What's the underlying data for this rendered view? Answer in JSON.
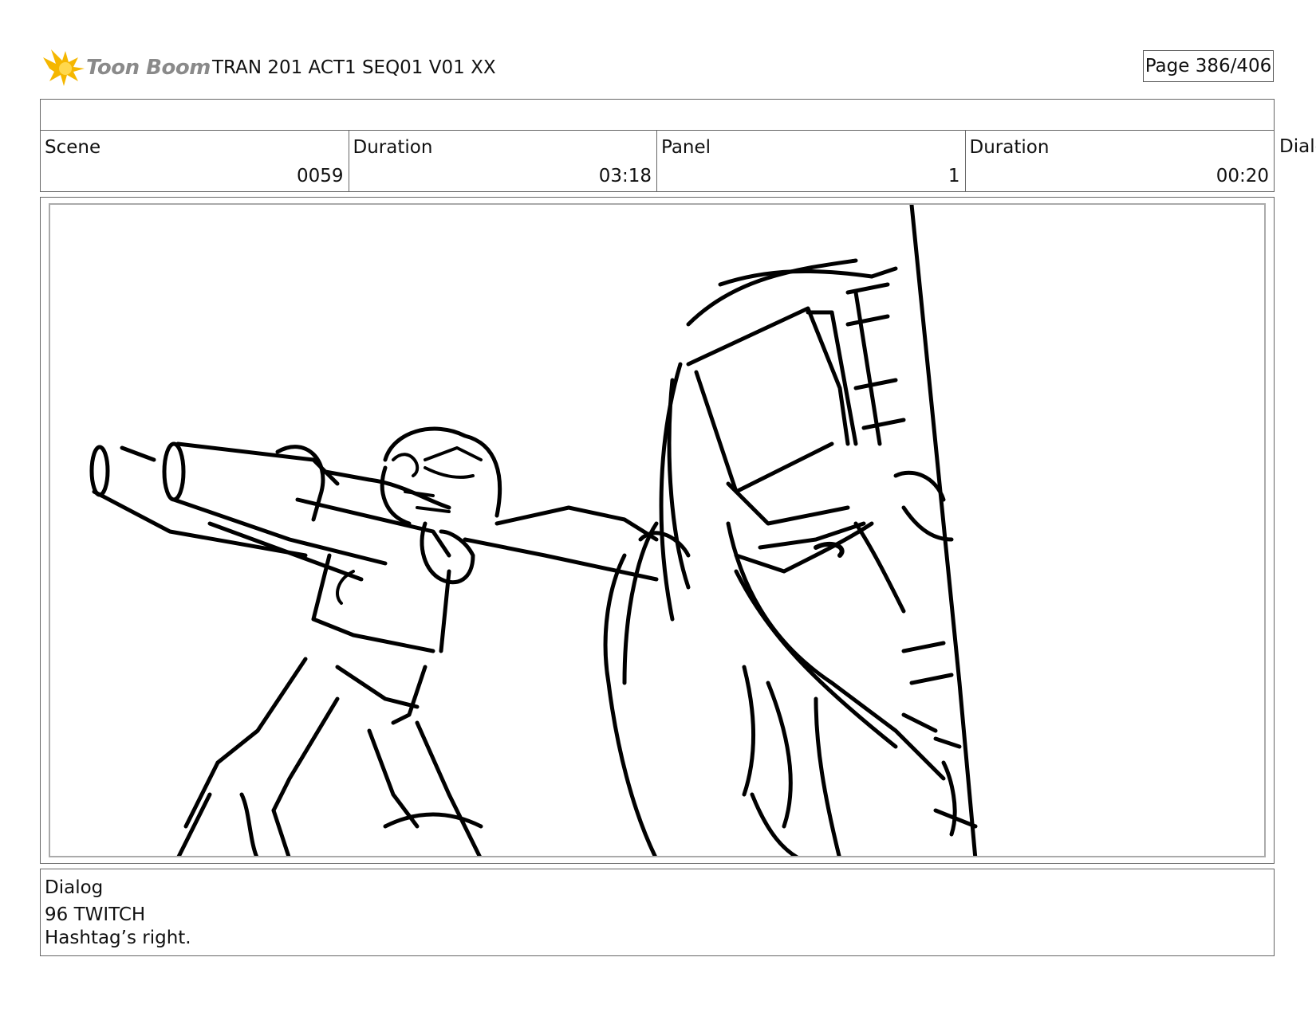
{
  "header": {
    "logo_text": "Toon Boom",
    "project_title": "TRAN 201 ACT1 SEQ01 V01 XX",
    "page_label": "Page 386/406"
  },
  "info": {
    "scene_label": "Scene",
    "scene_value": "0059",
    "scene_duration_label": "Duration",
    "scene_duration_value": "03:18",
    "panel_label": "Panel",
    "panel_value": "1",
    "panel_duration_label": "Duration",
    "panel_duration_value": "00:20",
    "overflow_label": "Dialo"
  },
  "dialog": {
    "label": "Dialog",
    "line1": "96 TWITCH",
    "line2": "Hashtag’s right."
  },
  "colors": {
    "logo_accent": "#f5b700",
    "border": "#666666",
    "sketch_ink": "#000000"
  }
}
